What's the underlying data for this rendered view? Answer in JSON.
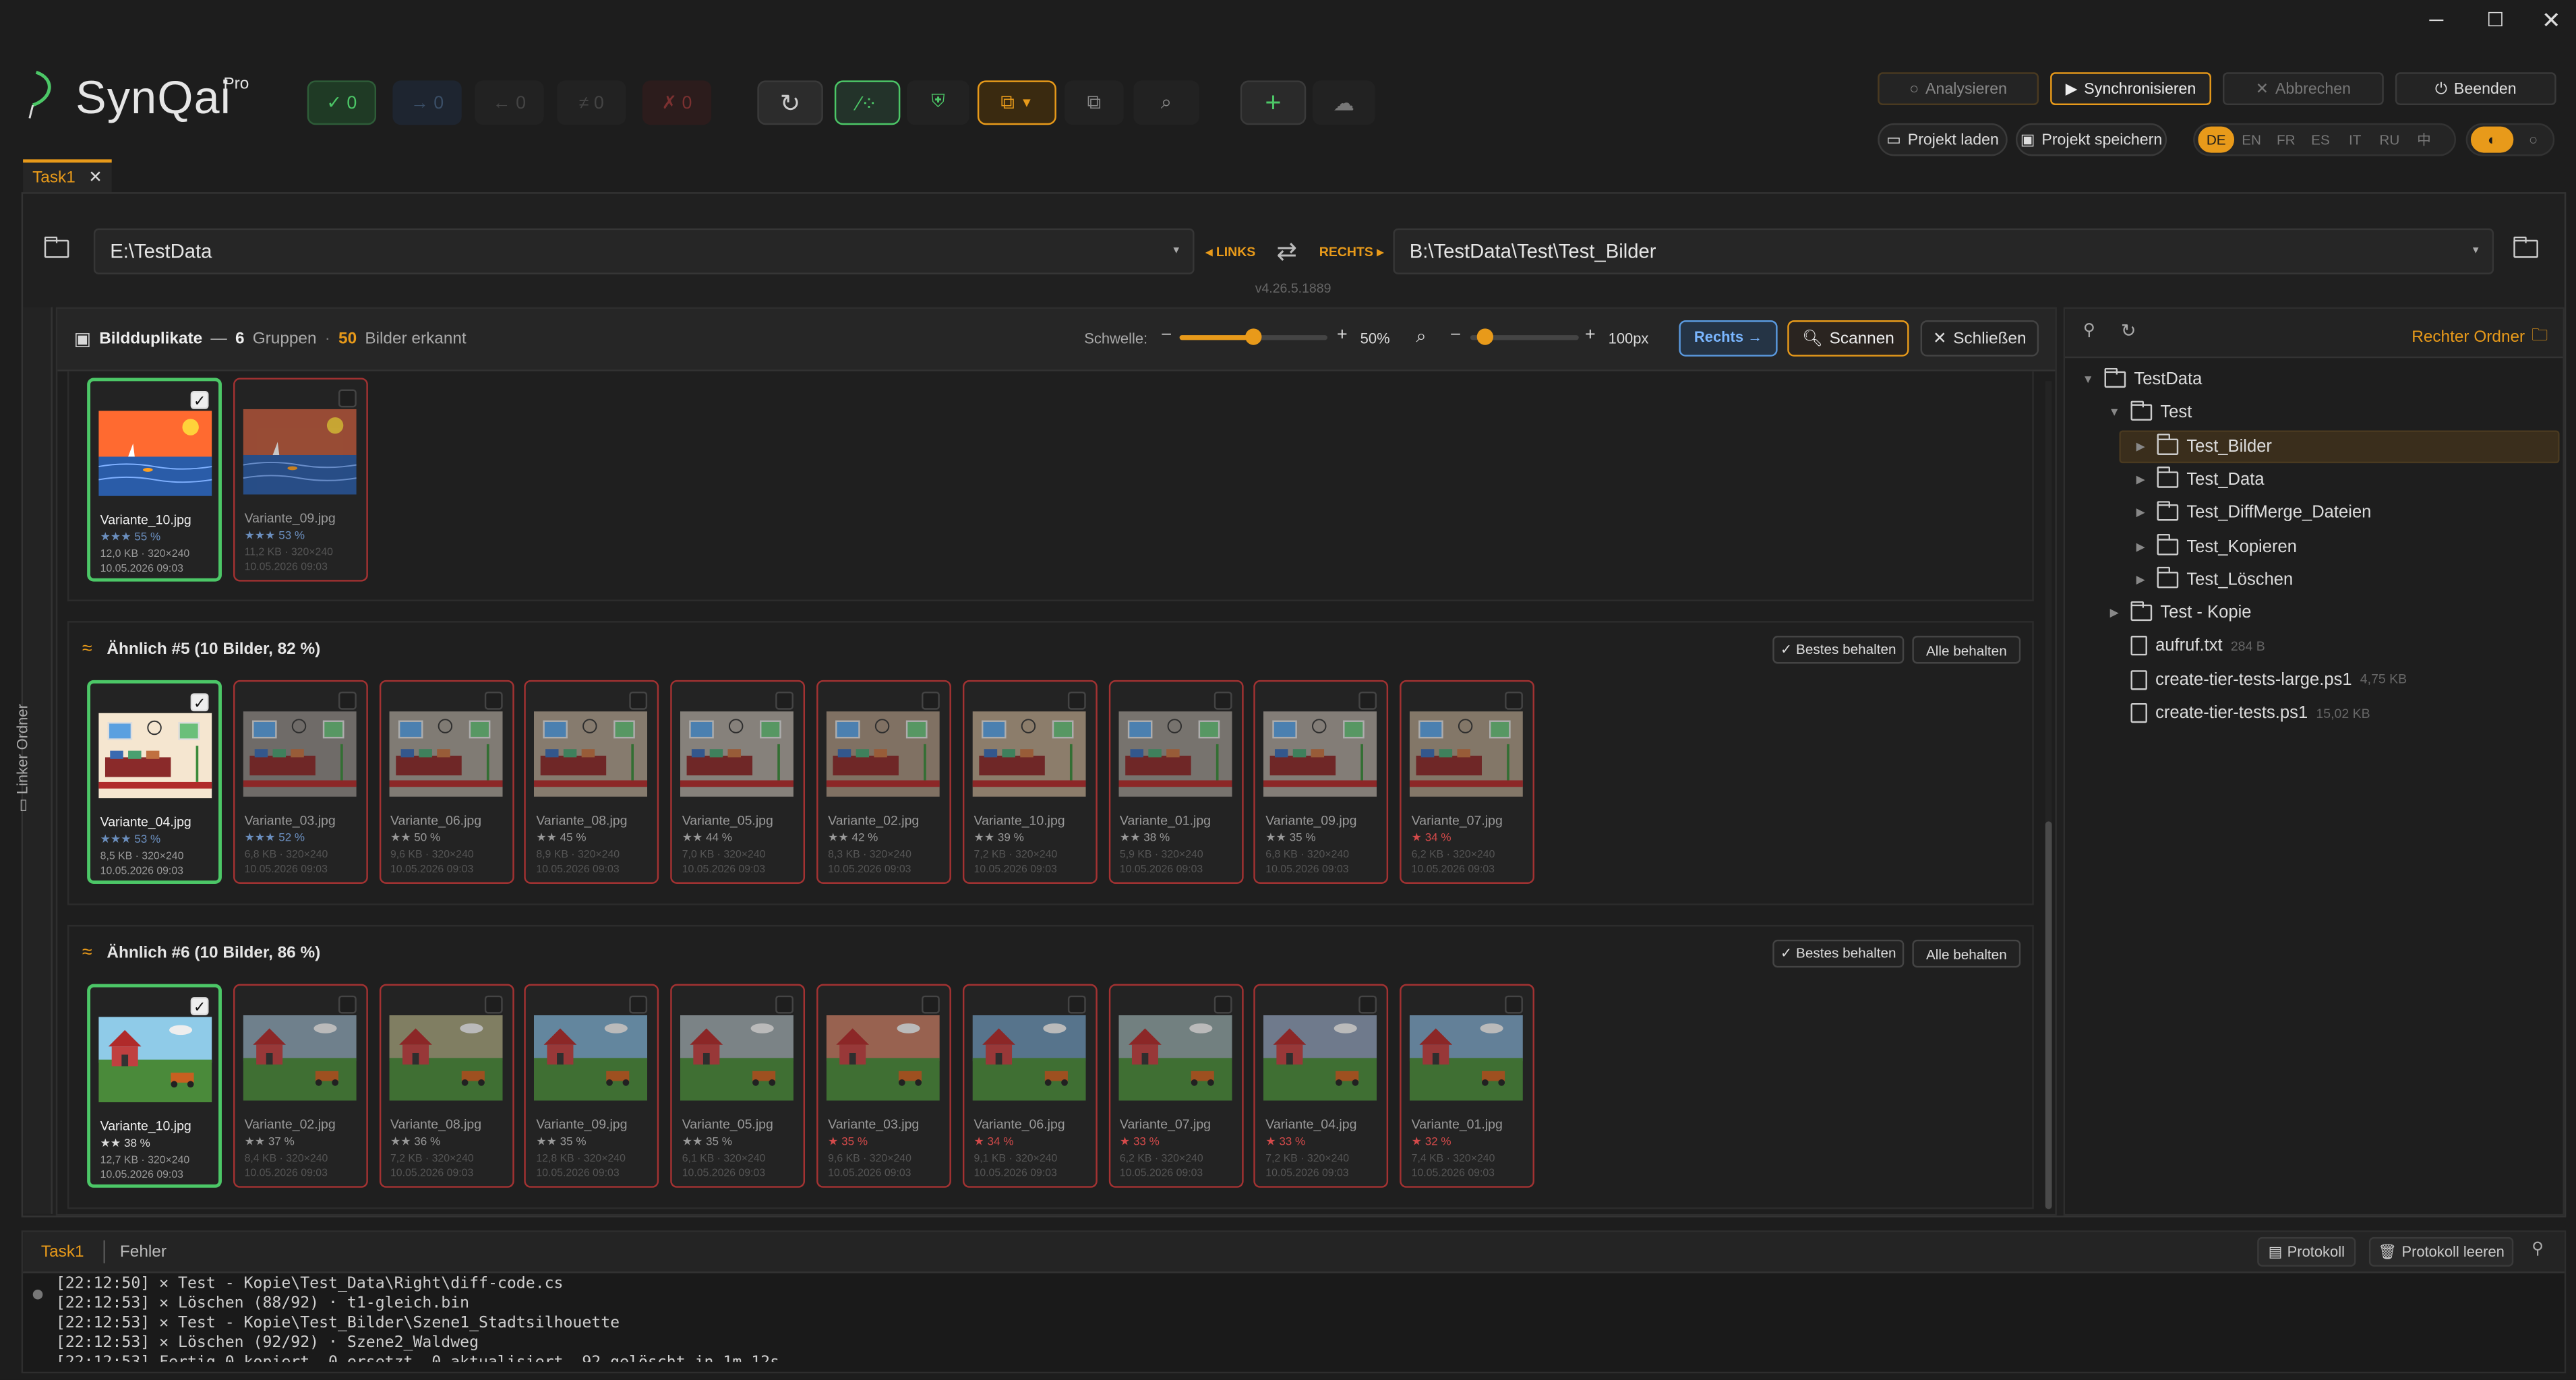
{
  "app": {
    "name": "SynQai",
    "edition": "Pro",
    "version": "v4.26.5.1889"
  },
  "counters": [
    {
      "icon": "check-icon",
      "value": "0",
      "color": "#4cc767"
    },
    {
      "icon": "arrow-right-icon",
      "value": "0",
      "color": "#4a6a8a"
    },
    {
      "icon": "arrow-left-icon",
      "value": "0",
      "color": "#666"
    },
    {
      "icon": "not-equal-icon",
      "value": "0",
      "color": "#666"
    },
    {
      "icon": "x-icon",
      "value": "0",
      "color": "#c94040"
    }
  ],
  "header_buttons": {
    "analyze": "Analysieren",
    "sync": "Synchronisieren",
    "abort": "Abbrechen",
    "quit": "Beenden",
    "load_project": "Projekt laden",
    "save_project": "Projekt speichern"
  },
  "languages": [
    "DE",
    "EN",
    "FR",
    "ES",
    "IT",
    "RU",
    "中"
  ],
  "active_language": "DE",
  "tab": {
    "label": "Task1"
  },
  "paths": {
    "left": "E:\\TestData",
    "right": "B:\\TestData\\Test\\Test_Bilder",
    "left_label": "◂ LINKS",
    "right_label": "RECHTS ▸"
  },
  "toolbar": {
    "title": "Bildduplikate",
    "dash": "—",
    "groups_count": "6",
    "groups_label": "Gruppen",
    "dot": "·",
    "images_count": "50",
    "images_label": "Bilder erkannt",
    "threshold_label": "Schwelle:",
    "threshold_value": "50%",
    "zoom_value": "100px",
    "right_btn": "Rechts →",
    "scan_btn": "Scannen",
    "close_btn": "Schließen",
    "minus": "–",
    "plus": "+"
  },
  "left_sidebar_label": "Linker Ordner",
  "groups": [
    {
      "title": "",
      "keep_best": "",
      "keep_all": "",
      "items": [
        {
          "file": "Variante_10.jpg",
          "stars": "★★★ 55 %",
          "size": "12,0 KB · 320×240",
          "date": "10.05.2026 09:03",
          "selected": true
        },
        {
          "file": "Variante_09.jpg",
          "stars": "★★★ 53 %",
          "size": "11,2 KB · 320×240",
          "date": "10.05.2026 09:03",
          "selected": false
        }
      ]
    },
    {
      "title": "Ähnlich #5 (10 Bilder, 82 %)",
      "keep_best": "✓ Bestes behalten",
      "keep_all": "Alle behalten",
      "items": [
        {
          "file": "Variante_04.jpg",
          "stars": "★★★ 53 %",
          "size": "8,5 KB · 320×240",
          "date": "10.05.2026 09:03",
          "selected": true
        },
        {
          "file": "Variante_03.jpg",
          "stars": "★★★ 52 %",
          "size": "6,8 KB · 320×240",
          "date": "10.05.2026 09:03",
          "selected": false
        },
        {
          "file": "Variante_06.jpg",
          "stars": "★★ 50 %",
          "size": "9,6 KB · 320×240",
          "date": "10.05.2026 09:03",
          "selected": false
        },
        {
          "file": "Variante_08.jpg",
          "stars": "★★ 45 %",
          "size": "8,9 KB · 320×240",
          "date": "10.05.2026 09:03",
          "selected": false
        },
        {
          "file": "Variante_05.jpg",
          "stars": "★★ 44 %",
          "size": "7,0 KB · 320×240",
          "date": "10.05.2026 09:03",
          "selected": false
        },
        {
          "file": "Variante_02.jpg",
          "stars": "★★ 42 %",
          "size": "8,3 KB · 320×240",
          "date": "10.05.2026 09:03",
          "selected": false
        },
        {
          "file": "Variante_10.jpg",
          "stars": "★★ 39 %",
          "size": "7,2 KB · 320×240",
          "date": "10.05.2026 09:03",
          "selected": false
        },
        {
          "file": "Variante_01.jpg",
          "stars": "★★ 38 %",
          "size": "5,9 KB · 320×240",
          "date": "10.05.2026 09:03",
          "selected": false
        },
        {
          "file": "Variante_09.jpg",
          "stars": "★★ 35 %",
          "size": "6,8 KB · 320×240",
          "date": "10.05.2026 09:03",
          "selected": false
        },
        {
          "file": "Variante_07.jpg",
          "stars": "★ 34 %",
          "size": "6,2 KB · 320×240",
          "date": "10.05.2026 09:03",
          "selected": false
        }
      ]
    },
    {
      "title": "Ähnlich #6 (10 Bilder, 86 %)",
      "keep_best": "✓ Bestes behalten",
      "keep_all": "Alle behalten",
      "items": [
        {
          "file": "Variante_10.jpg",
          "stars": "★★ 38 %",
          "size": "12,7 KB · 320×240",
          "date": "10.05.2026 09:03",
          "selected": true
        },
        {
          "file": "Variante_02.jpg",
          "stars": "★★ 37 %",
          "size": "8,4 KB · 320×240",
          "date": "10.05.2026 09:03",
          "selected": false
        },
        {
          "file": "Variante_08.jpg",
          "stars": "★★ 36 %",
          "size": "7,2 KB · 320×240",
          "date": "10.05.2026 09:03",
          "selected": false
        },
        {
          "file": "Variante_09.jpg",
          "stars": "★★ 35 %",
          "size": "12,8 KB · 320×240",
          "date": "10.05.2026 09:03",
          "selected": false
        },
        {
          "file": "Variante_05.jpg",
          "stars": "★★ 35 %",
          "size": "6,1 KB · 320×240",
          "date": "10.05.2026 09:03",
          "selected": false
        },
        {
          "file": "Variante_03.jpg",
          "stars": "★ 35 %",
          "size": "9,6 KB · 320×240",
          "date": "10.05.2026 09:03",
          "selected": false
        },
        {
          "file": "Variante_06.jpg",
          "stars": "★ 34 %",
          "size": "9,1 KB · 320×240",
          "date": "10.05.2026 09:03",
          "selected": false
        },
        {
          "file": "Variante_07.jpg",
          "stars": "★ 33 %",
          "size": "6,2 KB · 320×240",
          "date": "10.05.2026 09:03",
          "selected": false
        },
        {
          "file": "Variante_04.jpg",
          "stars": "★ 33 %",
          "size": "7,2 KB · 320×240",
          "date": "10.05.2026 09:03",
          "selected": false
        },
        {
          "file": "Variante_01.jpg",
          "stars": "★ 32 %",
          "size": "7,4 KB · 320×240",
          "date": "10.05.2026 09:03",
          "selected": false
        }
      ]
    }
  ],
  "right_panel": {
    "title": "Rechter Ordner",
    "tree": [
      {
        "label": "TestData",
        "level": 0,
        "type": "folder",
        "expanded": true,
        "size": ""
      },
      {
        "label": "Test",
        "level": 1,
        "type": "folder",
        "expanded": true,
        "size": ""
      },
      {
        "label": "Test_Bilder",
        "level": 2,
        "type": "folder",
        "expanded": false,
        "selected": true,
        "size": ""
      },
      {
        "label": "Test_Data",
        "level": 2,
        "type": "folder",
        "expanded": false,
        "size": ""
      },
      {
        "label": "Test_DiffMerge_Dateien",
        "level": 2,
        "type": "folder",
        "expanded": false,
        "size": ""
      },
      {
        "label": "Test_Kopieren",
        "level": 2,
        "type": "folder",
        "expanded": false,
        "size": ""
      },
      {
        "label": "Test_Löschen",
        "level": 2,
        "type": "folder",
        "expanded": false,
        "size": ""
      },
      {
        "label": "Test - Kopie",
        "level": 1,
        "type": "folder",
        "expanded": false,
        "size": ""
      },
      {
        "label": "aufruf.txt",
        "level": 1,
        "type": "file",
        "size": "284 B"
      },
      {
        "label": "create-tier-tests-large.ps1",
        "level": 1,
        "type": "file",
        "size": "4,75 KB"
      },
      {
        "label": "create-tier-tests.ps1",
        "level": 1,
        "type": "file",
        "size": "15,02 KB"
      }
    ]
  },
  "bottom": {
    "tab_task": "Task1",
    "tab_errors": "Fehler",
    "protocol": "Protokoll",
    "clear_protocol": "Protokoll leeren",
    "log": [
      "[22:12:50] ✕ Test - Kopie\\Test_Data\\Right\\diff-code.cs",
      "[22:12:53] ✕ Löschen (88/92) · t1-gleich.bin",
      "[22:12:53] ✕ Test - Kopie\\Test_Bilder\\Szene1_Stadtsilhouette",
      "[22:12:53] ✕ Löschen (92/92) · Szene2_Waldweg",
      "[22:12:53] Fertig 0 kopiert, 0 ersetzt, 0 aktualisiert, 92 gelöscht in 1m 12s"
    ]
  },
  "colors": {
    "accent": "#e89a1a",
    "ok": "#4cc767",
    "bad": "#a33232",
    "blue": "#5a9ae0"
  }
}
